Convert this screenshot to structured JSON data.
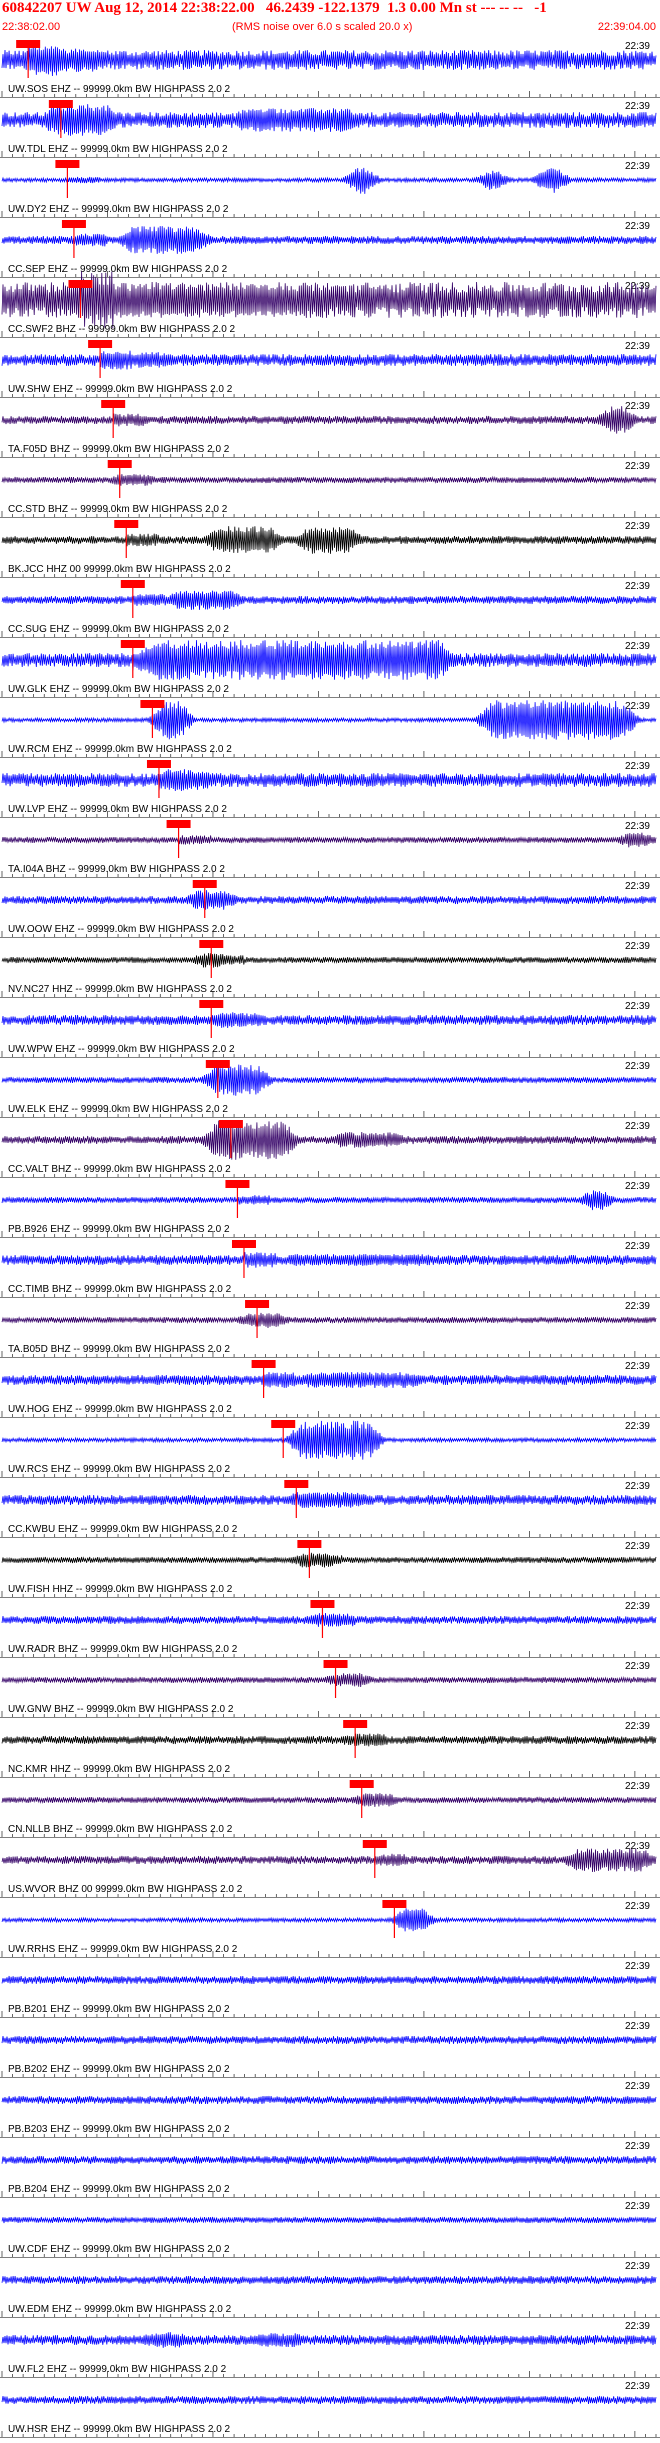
{
  "header": {
    "title": "60842207 UW Aug 12, 2014 22:38:22.00   46.2439 -122.1379  1.3 0.00 Mn st --- -- --   -1",
    "start_time": "22:38:02.00",
    "note": "(RMS noise over 6.0 s scaled 20.0 x)",
    "end_time": "22:39:04.00"
  },
  "chart_data": {
    "type": "line",
    "time_range": [
      "22:38:02.00",
      "22:39:04.00"
    ],
    "row_time_label": "22:39",
    "colors": {
      "blue": "#0000ff",
      "dark": "#330066",
      "black": "#000000",
      "red": "#ff0000",
      "pick_box": "#ff0000"
    },
    "series": [
      {
        "name": "UW.SOS EHZ -- 99999.0km BW HIGHPASS 2.0 2",
        "color": "blue",
        "pick": 0.04,
        "amp": 10,
        "bursts": [
          [
            0.09,
            12,
            0.05
          ]
        ]
      },
      {
        "name": "UW.TDL EHZ -- 99999.0km BW HIGHPASS 2.0 2",
        "color": "blue",
        "pick": 0.09,
        "amp": 8,
        "bursts": [
          [
            0.12,
            16,
            0.04
          ],
          [
            0.45,
            12,
            0.08
          ]
        ]
      },
      {
        "name": "UW.DY2 EHZ -- 99999.0km BW HIGHPASS 2.0 2",
        "color": "blue",
        "pick": 0.1,
        "amp": 2,
        "bursts": [
          [
            0.55,
            14,
            0.005
          ],
          [
            0.75,
            10,
            0.005
          ],
          [
            0.84,
            14,
            0.005
          ]
        ]
      },
      {
        "name": "CC.SEP EHZ -- 99999.0km BW HIGHPASS 2.0 2",
        "color": "blue",
        "pick": 0.11,
        "amp": 4,
        "bursts": [
          [
            0.25,
            14,
            0.05
          ]
        ]
      },
      {
        "name": "CC.SWF2 BHZ -- 99999.0km BW HIGHPASS 2.0 2",
        "color": "dark",
        "pick": 0.12,
        "amp": 18,
        "bursts": [
          [
            0.3,
            16,
            0.2
          ]
        ]
      },
      {
        "name": "UW.SHW EHZ -- 99999.0km BW HIGHPASS 2.0 2",
        "color": "blue",
        "pick": 0.15,
        "amp": 6,
        "bursts": [
          [
            0.23,
            8,
            0.02
          ]
        ]
      },
      {
        "name": "TA.F05D BHZ -- 99999.0km BW HIGHPASS 2.0 2",
        "color": "dark",
        "pick": 0.17,
        "amp": 4,
        "bursts": [
          [
            0.94,
            14,
            0.01
          ]
        ]
      },
      {
        "name": "CC.STD BHZ -- 99999.0km BW HIGHPASS 2.0 2",
        "color": "dark",
        "pick": 0.18,
        "amp": 3,
        "bursts": [
          [
            0.2,
            6,
            0.02
          ]
        ]
      },
      {
        "name": "BK.JCC HHZ 00 99999.0km BW HIGHPASS 2.0 2",
        "color": "black",
        "pick": 0.19,
        "amp": 4,
        "bursts": [
          [
            0.37,
            14,
            0.04
          ],
          [
            0.5,
            14,
            0.03
          ]
        ]
      },
      {
        "name": "CC.SUG EHZ -- 99999.0km BW HIGHPASS 2.0 2",
        "color": "blue",
        "pick": 0.2,
        "amp": 4,
        "bursts": [
          [
            0.31,
            10,
            0.04
          ]
        ]
      },
      {
        "name": "UW.GLK EHZ -- 99999.0km BW HIGHPASS 2.0 2",
        "color": "blue",
        "pick": 0.2,
        "amp": 7,
        "bursts": [
          [
            0.45,
            20,
            0.22
          ]
        ]
      },
      {
        "name": "UW.RCM EHZ -- 99999.0km BW HIGHPASS 2.0 2",
        "color": "blue",
        "pick": 0.23,
        "amp": 2,
        "bursts": [
          [
            0.26,
            20,
            0.01
          ],
          [
            0.85,
            20,
            0.1
          ]
        ]
      },
      {
        "name": "UW.LVP EHZ -- 99999.0km BW HIGHPASS 2.0 2",
        "color": "blue",
        "pick": 0.24,
        "amp": 7,
        "bursts": [
          [
            0.28,
            10,
            0.03
          ]
        ]
      },
      {
        "name": "TA.I04A BHZ -- 99999.0km BW HIGHPASS 2.0 2",
        "color": "dark",
        "pick": 0.27,
        "amp": 3,
        "bursts": [
          [
            0.97,
            8,
            0.01
          ]
        ]
      },
      {
        "name": "UW.OOW EHZ -- 99999.0km BW HIGHPASS 2.0 2",
        "color": "blue",
        "pick": 0.31,
        "amp": 4,
        "bursts": [
          [
            0.32,
            10,
            0.02
          ]
        ]
      },
      {
        "name": "NV.NC27 HHZ -- 99999.0km BW HIGHPASS 2.0 2",
        "color": "black",
        "pick": 0.32,
        "amp": 3,
        "bursts": [
          [
            0.32,
            8,
            0.01
          ]
        ]
      },
      {
        "name": "UW.WPW EHZ -- 99999.0km BW HIGHPASS 2.0 2",
        "color": "blue",
        "pick": 0.32,
        "amp": 5,
        "bursts": [
          [
            0.36,
            7,
            0.03
          ]
        ]
      },
      {
        "name": "UW.ELK EHZ -- 99999.0km BW HIGHPASS 2.0 2",
        "color": "blue",
        "pick": 0.33,
        "amp": 3,
        "bursts": [
          [
            0.36,
            16,
            0.03
          ]
        ]
      },
      {
        "name": "CC.VALT BHZ -- 99999.0km BW HIGHPASS 2.0 2",
        "color": "dark",
        "pick": 0.35,
        "amp": 4,
        "bursts": [
          [
            0.38,
            20,
            0.05
          ],
          [
            0.56,
            8,
            0.04
          ]
        ]
      },
      {
        "name": "PB.B926 EHZ -- 99999.0km BW HIGHPASS 2.0 2",
        "color": "blue",
        "pick": 0.36,
        "amp": 3,
        "bursts": [
          [
            0.91,
            12,
            0.005
          ]
        ]
      },
      {
        "name": "CC.TIMB BHZ -- 99999.0km BW HIGHPASS 2.0 2",
        "color": "blue",
        "pick": 0.37,
        "amp": 5,
        "bursts": [
          [
            0.55,
            6,
            0.1
          ]
        ]
      },
      {
        "name": "TA.B05D BHZ -- 99999.0km BW HIGHPASS 2.0 2",
        "color": "dark",
        "pick": 0.39,
        "amp": 3,
        "bursts": [
          [
            0.4,
            8,
            0.02
          ]
        ]
      },
      {
        "name": "UW.HOG EHZ -- 99999.0km BW HIGHPASS 2.0 2",
        "color": "blue",
        "pick": 0.4,
        "amp": 5,
        "bursts": [
          [
            0.55,
            8,
            0.08
          ]
        ]
      },
      {
        "name": "UW.RCS EHZ -- 99999.0km BW HIGHPASS 2.0 2",
        "color": "blue",
        "pick": 0.43,
        "amp": 2,
        "bursts": [
          [
            0.51,
            20,
            0.05
          ]
        ]
      },
      {
        "name": "CC.KWBU EHZ -- 99999.0km BW HIGHPASS 2.0 2",
        "color": "blue",
        "pick": 0.45,
        "amp": 5,
        "bursts": [
          [
            0.5,
            8,
            0.05
          ]
        ]
      },
      {
        "name": "UW.FISH HHZ -- 99999.0km BW HIGHPASS 2.0 2",
        "color": "black",
        "pick": 0.47,
        "amp": 3,
        "bursts": [
          [
            0.48,
            8,
            0.02
          ]
        ]
      },
      {
        "name": "UW.RADR BHZ -- 99999.0km BW HIGHPASS 2.0 2",
        "color": "blue",
        "pick": 0.49,
        "amp": 4,
        "bursts": [
          [
            0.5,
            7,
            0.02
          ]
        ]
      },
      {
        "name": "UW.GNW BHZ -- 99999.0km BW HIGHPASS 2.0 2",
        "color": "dark",
        "pick": 0.51,
        "amp": 3,
        "bursts": [
          [
            0.53,
            7,
            0.02
          ]
        ]
      },
      {
        "name": "NC.KMR HHZ -- 99999.0km BW HIGHPASS 2.0 2",
        "color": "black",
        "pick": 0.54,
        "amp": 4,
        "bursts": [
          [
            0.55,
            6,
            0.02
          ]
        ]
      },
      {
        "name": "CN.NLLB BHZ -- 99999.0km BW HIGHPASS 2.0 2",
        "color": "dark",
        "pick": 0.55,
        "amp": 3,
        "bursts": [
          [
            0.57,
            7,
            0.02
          ]
        ]
      },
      {
        "name": "US.WVOR BHZ 00 99999.0km BW HIGHPASS 2.0 2",
        "color": "dark",
        "pick": 0.57,
        "amp": 4,
        "bursts": [
          [
            0.93,
            12,
            0.05
          ]
        ]
      },
      {
        "name": "UW.RRHS EHZ -- 99999.0km BW HIGHPASS 2.0 2",
        "color": "blue",
        "pick": 0.6,
        "amp": 2,
        "bursts": [
          [
            0.63,
            14,
            0.01
          ]
        ]
      },
      {
        "name": "PB.B201 EHZ -- 99999.0km BW HIGHPASS 2.0 2",
        "color": "blue",
        "pick": null,
        "amp": 4,
        "bursts": []
      },
      {
        "name": "PB.B202 EHZ -- 99999.0km BW HIGHPASS 2.0 2",
        "color": "blue",
        "pick": null,
        "amp": 4,
        "bursts": []
      },
      {
        "name": "PB.B203 EHZ -- 99999.0km BW HIGHPASS 2.0 2",
        "color": "blue",
        "pick": null,
        "amp": 4,
        "bursts": []
      },
      {
        "name": "PB.B204 EHZ -- 99999.0km BW HIGHPASS 2.0 2",
        "color": "blue",
        "pick": null,
        "amp": 4,
        "bursts": []
      },
      {
        "name": "UW.CDF EHZ -- 99999.0km BW HIGHPASS 2.0 2",
        "color": "blue",
        "pick": null,
        "amp": 3,
        "bursts": []
      },
      {
        "name": "UW.EDM EHZ -- 99999.0km BW HIGHPASS 2.0 2",
        "color": "blue",
        "pick": null,
        "amp": 4,
        "bursts": []
      },
      {
        "name": "UW.FL2 EHZ -- 99999.0km BW HIGHPASS 2.0 2",
        "color": "blue",
        "pick": null,
        "amp": 5,
        "bursts": [
          [
            0.25,
            8,
            0.02
          ],
          [
            0.42,
            7,
            0.03
          ]
        ]
      },
      {
        "name": "UW.HSR EHZ -- 99999.0km BW HIGHPASS 2.0 2",
        "color": "blue",
        "pick": null,
        "amp": 4,
        "bursts": []
      }
    ]
  }
}
